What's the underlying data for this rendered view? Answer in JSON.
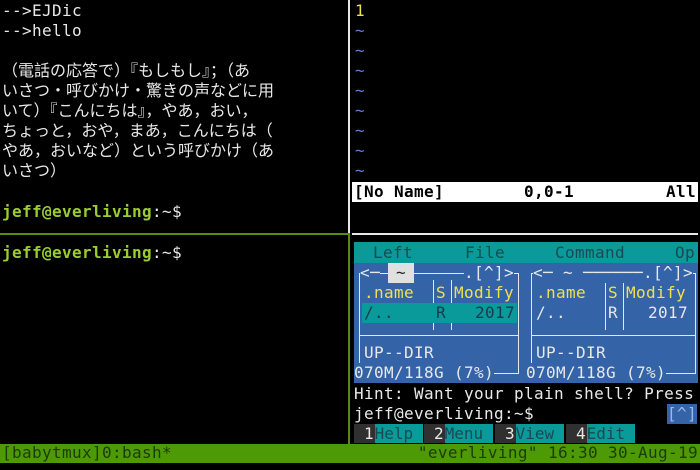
{
  "left_top": {
    "lines": [
      "-->EJDic",
      "-->hello",
      "",
      "（電話の応答で）『もしもし』；（あ",
      "いさつ・呼びかけ・驚きの声などに用",
      "いて）『こんにちは』，やあ，おい，",
      "ちょっと，おや，まあ，こんにちは（",
      "やあ，おいなど）という呼びかけ（あ",
      "いさつ）"
    ],
    "prompt_user": "jeff@everliving",
    "prompt_path": ":~$"
  },
  "left_bottom": {
    "prompt_user": "jeff@everliving",
    "prompt_path": ":~$"
  },
  "vim": {
    "line_number": "1",
    "tilde": "~",
    "filename": "[No Name]",
    "position": "0,0-1",
    "scroll": "All"
  },
  "mc": {
    "menu": [
      "Left",
      "File",
      "Command",
      "Op"
    ],
    "left_panel": {
      "header_left": "<─",
      "path": "~",
      "header_right": ".[^]>",
      "col_name": ".name",
      "col_size": "S",
      "col_modify": "Modify",
      "row_name": "/..",
      "row_size": "R",
      "row_modify": "2017",
      "mini_status": "UP--DIR",
      "disk": "070M/118G (7%)"
    },
    "right_panel": {
      "header": "<─ ~ ──────.[^]>",
      "col_name": ".name",
      "col_size": "S",
      "col_modify": "Modify",
      "row_name": "/..",
      "row_size": "R",
      "row_modify": "2017",
      "mini_status": "UP--DIR",
      "disk": "070M/118G (7%)"
    },
    "hint": "Hint: Want your plain shell? Press",
    "prompt": "jeff@everliving:~$",
    "history_button": "[^]",
    "fkeys": [
      {
        "n": "1",
        "label": "Help"
      },
      {
        "n": "2",
        "label": "Menu"
      },
      {
        "n": "3",
        "label": "View"
      },
      {
        "n": "4",
        "label": "Edit"
      }
    ]
  },
  "status": {
    "session": "[babytmux]0:bash*",
    "host": "\"everliving\" 16:30 30-Aug-19"
  }
}
